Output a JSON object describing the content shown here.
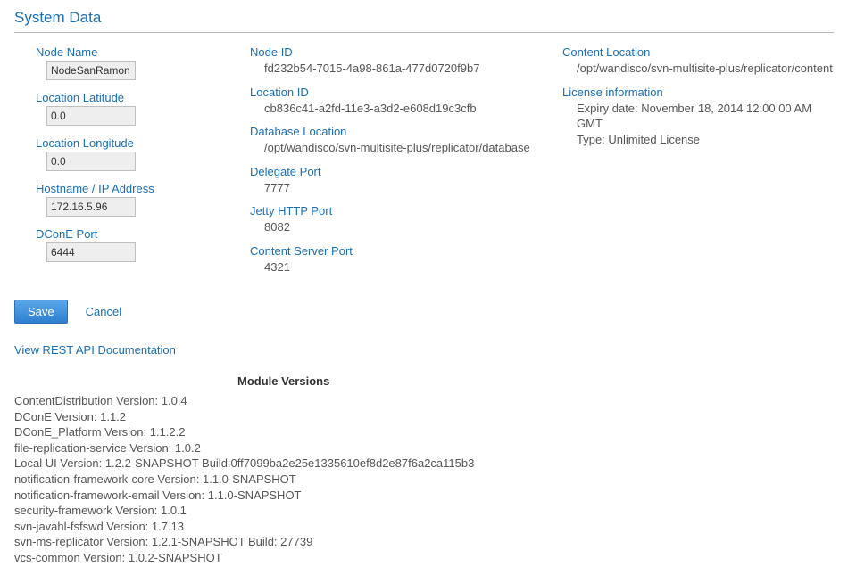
{
  "title": "System Data",
  "leftFields": [
    {
      "label": "Node Name",
      "value": "NodeSanRamon"
    },
    {
      "label": "Location Latitude",
      "value": "0.0"
    },
    {
      "label": "Location Longitude",
      "value": "0.0"
    },
    {
      "label": "Hostname / IP Address",
      "value": "172.16.5.96"
    },
    {
      "label": "DConE Port",
      "value": "6444"
    }
  ],
  "midFields": [
    {
      "label": "Node ID",
      "value": "fd232b54-7015-4a98-861a-477d0720f9b7"
    },
    {
      "label": "Location ID",
      "value": "cb836c41-a2fd-11e3-a3d2-e608d19c3cfb"
    },
    {
      "label": "Database Location",
      "value": "/opt/wandisco/svn-multisite-plus/replicator/database"
    },
    {
      "label": "Delegate Port",
      "value": "7777"
    },
    {
      "label": "Jetty HTTP Port",
      "value": "8082"
    },
    {
      "label": "Content Server Port",
      "value": "4321"
    }
  ],
  "rightFields": [
    {
      "label": "Content Location",
      "value": "/opt/wandisco/svn-multisite-plus/replicator/content"
    },
    {
      "label": "License information",
      "value": "Expiry date: November 18, 2014 12:00:00 AM GMT\nType: Unlimited License"
    }
  ],
  "buttons": {
    "save": "Save",
    "cancel": "Cancel"
  },
  "apiLink": "View REST API Documentation",
  "moduleHeader": "Module Versions",
  "modules": [
    "ContentDistribution Version: 1.0.4",
    "DConE Version: 1.1.2",
    "DConE_Platform Version: 1.1.2.2",
    "file-replication-service Version: 1.0.2",
    "Local UI Version: 1.2.2-SNAPSHOT Build:0ff7099ba2e25e1335610ef8d2e87f6a2ca115b3",
    "notification-framework-core Version: 1.1.0-SNAPSHOT",
    "notification-framework-email Version: 1.1.0-SNAPSHOT",
    "security-framework Version: 1.0.1",
    "svn-javahl-fsfswd Version: 1.7.13",
    "svn-ms-replicator Version: 1.2.1-SNAPSHOT Build: 27739",
    "vcs-common Version: 1.0.2-SNAPSHOT"
  ]
}
